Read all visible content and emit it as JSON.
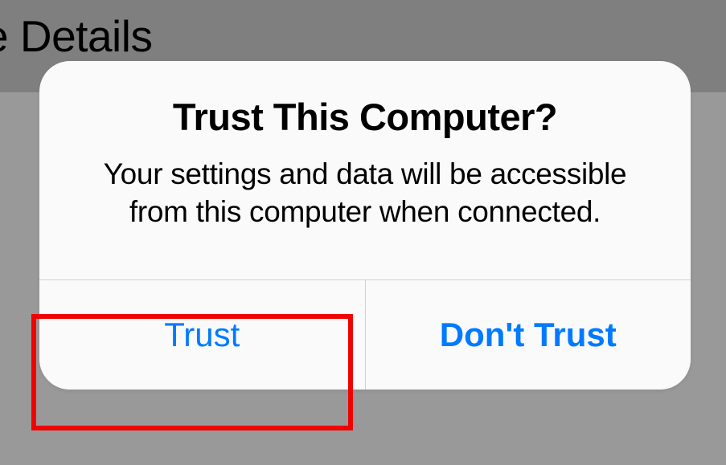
{
  "background": {
    "partial_title": "e Details"
  },
  "alert": {
    "title": "Trust This Computer?",
    "message": "Your settings and data will be accessible from this computer when connected.",
    "buttons": {
      "trust_label": "Trust",
      "dont_trust_label": "Don't Trust"
    }
  }
}
